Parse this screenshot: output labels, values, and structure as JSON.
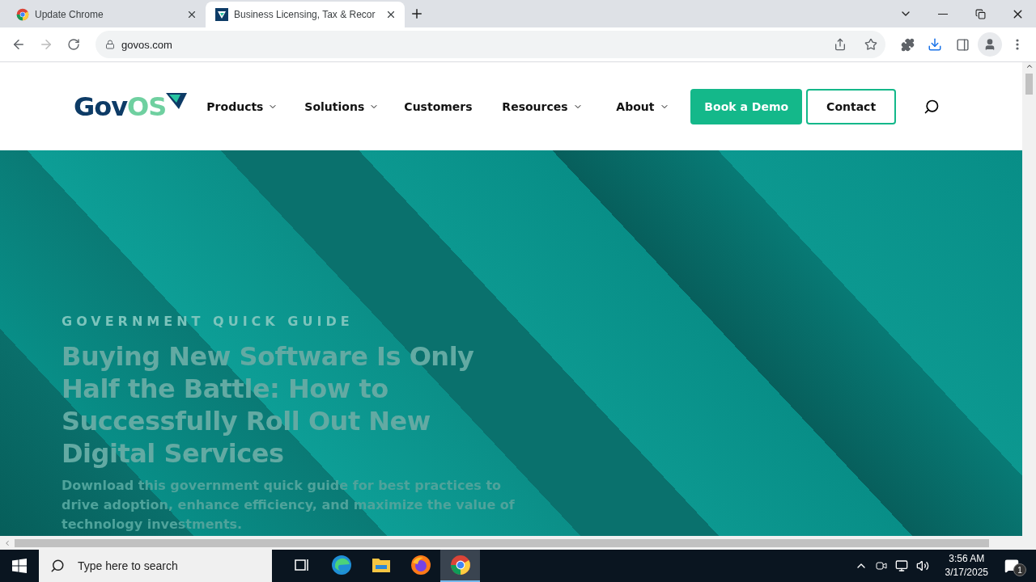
{
  "browser_tabs": [
    {
      "title": "Update Chrome",
      "kind": "chrome",
      "selected": false
    },
    {
      "title": "Business Licensing, Tax & Recor",
      "kind": "govos",
      "selected": true
    }
  ],
  "address_bar": {
    "url": "govos.com"
  },
  "site_header": {
    "logo": {
      "dark": "Gov",
      "light": "OS"
    },
    "nav": [
      {
        "label": "Products",
        "dropdown": true
      },
      {
        "label": "Solutions",
        "dropdown": true
      },
      {
        "label": "Customers",
        "dropdown": false
      },
      {
        "label": "Resources",
        "dropdown": true
      },
      {
        "label": "About",
        "dropdown": true
      }
    ],
    "primary_button": "Book a Demo",
    "secondary_button": "Contact"
  },
  "hero": {
    "eyebrow": "GOVERNMENT QUICK GUIDE",
    "headline": "Buying New Software Is Only Half the Battle: How to Successfully Roll Out New Digital Services",
    "body": "Download this government quick guide for best practices to drive adoption, enhance efficiency, and maximize the value of technology investments."
  },
  "taskbar": {
    "search_placeholder": "Type here to search",
    "apps": [
      {
        "kind": "taskview",
        "selected": false
      },
      {
        "kind": "edge",
        "selected": false
      },
      {
        "kind": "explorer",
        "selected": false
      },
      {
        "kind": "firefox",
        "selected": false
      },
      {
        "kind": "chrome",
        "selected": true
      }
    ],
    "time": "3:56 AM",
    "date": "3/17/2025",
    "notifications": "1"
  }
}
